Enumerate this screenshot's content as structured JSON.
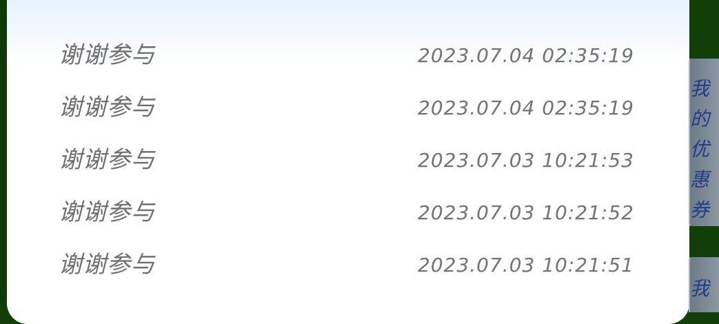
{
  "records": [
    {
      "label": "谢谢参与",
      "time": "2023.07.04 02:35:19"
    },
    {
      "label": "谢谢参与",
      "time": "2023.07.04 02:35:19"
    },
    {
      "label": "谢谢参与",
      "time": "2023.07.03 10:21:53"
    },
    {
      "label": "谢谢参与",
      "time": "2023.07.03 10:21:52"
    },
    {
      "label": "谢谢参与",
      "time": "2023.07.03 10:21:51"
    }
  ],
  "side_tabs": {
    "coupons": "我的优惠券",
    "second": "我"
  },
  "colors": {
    "background": "#123f08",
    "panel": "#ffffff",
    "text": "#6f6f6f",
    "tab_text": "#223c8a"
  }
}
